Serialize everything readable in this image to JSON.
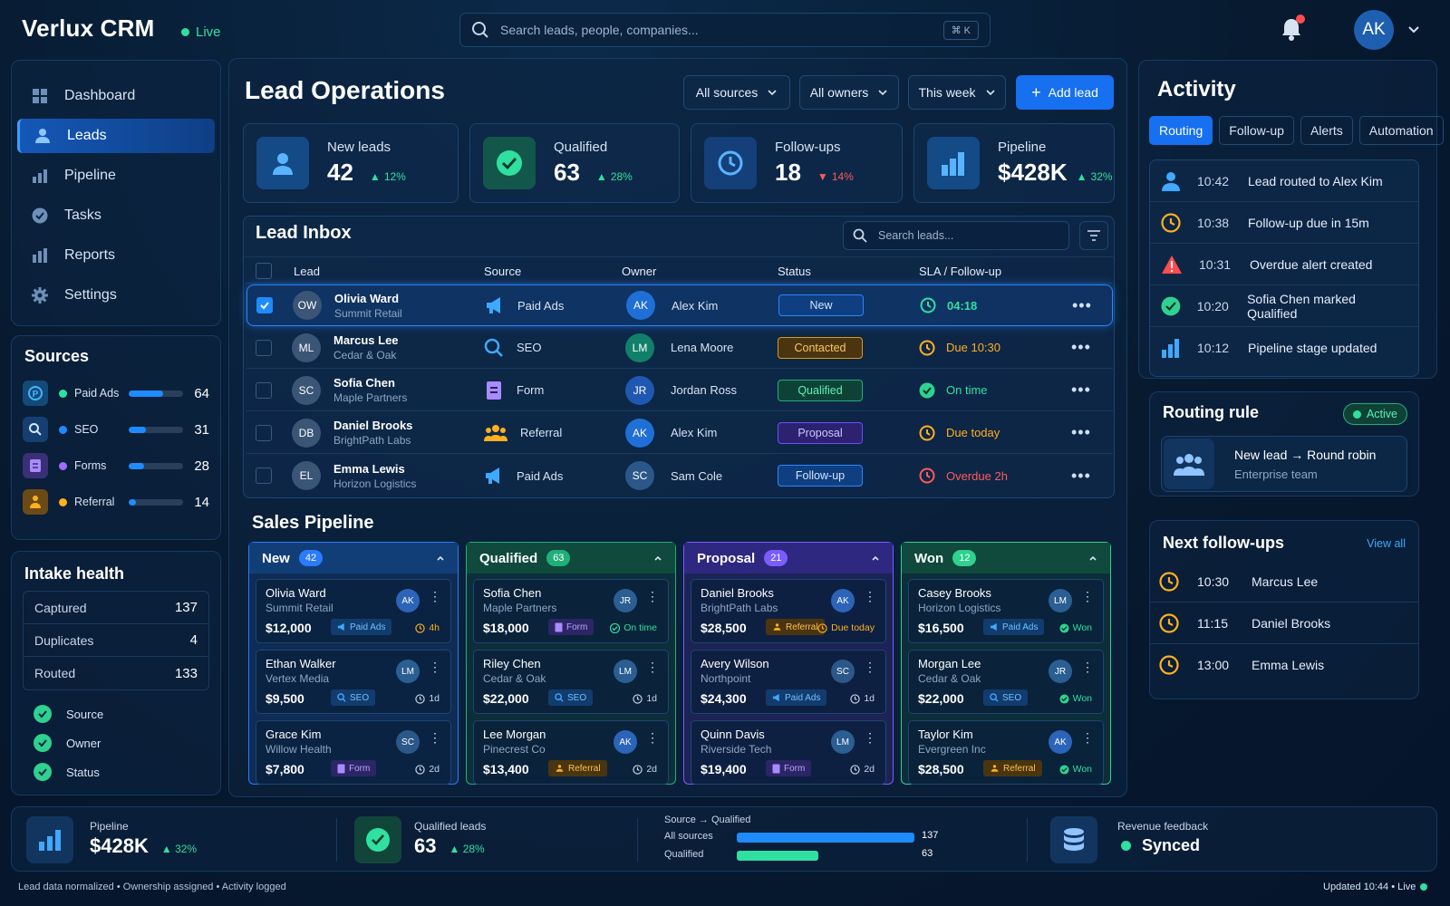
{
  "app": {
    "title": "Verlux CRM",
    "live": "Live"
  },
  "search": {
    "placeholder": "Search leads, people, companies...",
    "shortcut": "⌘ K"
  },
  "user": {
    "initials": "AK"
  },
  "sidebar": {
    "items": [
      {
        "label": "Dashboard",
        "icon": "grid-icon"
      },
      {
        "label": "Leads",
        "icon": "user-icon"
      },
      {
        "label": "Pipeline",
        "icon": "bar-chart-icon"
      },
      {
        "label": "Tasks",
        "icon": "check-circle-icon"
      },
      {
        "label": "Reports",
        "icon": "bar-chart-icon"
      },
      {
        "label": "Settings",
        "icon": "gear-icon"
      }
    ],
    "sources_title": "Sources",
    "sources": [
      {
        "label": "Paid Ads",
        "value": 64,
        "fraction": 0.64,
        "color": "#2fe0a0"
      },
      {
        "label": "SEO",
        "value": 31,
        "fraction": 0.31,
        "color": "#1e8bff"
      },
      {
        "label": "Forms",
        "value": 28,
        "fraction": 0.28,
        "color": "#a06bff"
      },
      {
        "label": "Referral",
        "value": 14,
        "fraction": 0.14,
        "color": "#ffb020"
      }
    ],
    "intake_title": "Intake health",
    "intake": [
      {
        "label": "Captured",
        "value": "137"
      },
      {
        "label": "Duplicates",
        "value": "4"
      },
      {
        "label": "Routed",
        "value": "133"
      }
    ],
    "checks": [
      "Source",
      "Owner",
      "Status"
    ]
  },
  "main": {
    "title": "Lead Operations",
    "filters": [
      "All sources",
      "All owners",
      "This week"
    ],
    "add_label": "Add lead",
    "kpis": [
      {
        "label": "New leads",
        "value": "42",
        "delta": "12%",
        "dir": "up"
      },
      {
        "label": "Qualified",
        "value": "63",
        "delta": "28%",
        "dir": "up"
      },
      {
        "label": "Follow-ups",
        "value": "18",
        "delta": "14%",
        "dir": "down"
      },
      {
        "label": "Pipeline",
        "value": "$428K",
        "delta": "32%",
        "dir": "up"
      }
    ]
  },
  "inbox": {
    "title": "Lead Inbox",
    "search_placeholder": "Search leads...",
    "columns": [
      "Lead",
      "Source",
      "Owner",
      "Status",
      "SLA / Follow-up"
    ],
    "rows": [
      {
        "initials": "OW",
        "name": "Olivia Ward",
        "company": "Summit Retail",
        "source": "Paid Ads",
        "owner_initials": "AK",
        "owner": "Alex Kim",
        "status": "New",
        "sla": "04:18",
        "sla_kind": "ok"
      },
      {
        "initials": "ML",
        "name": "Marcus Lee",
        "company": "Cedar & Oak",
        "source": "SEO",
        "owner_initials": "LM",
        "owner": "Lena Moore",
        "status": "Contacted",
        "sla": "Due 10:30",
        "sla_kind": "due"
      },
      {
        "initials": "SC",
        "name": "Sofia Chen",
        "company": "Maple Partners",
        "source": "Form",
        "owner_initials": "JR",
        "owner": "Jordan Ross",
        "status": "Qualified",
        "sla": "On time",
        "sla_kind": "done"
      },
      {
        "initials": "DB",
        "name": "Daniel Brooks",
        "company": "BrightPath Labs",
        "source": "Referral",
        "owner_initials": "AK",
        "owner": "Alex Kim",
        "status": "Proposal",
        "sla": "Due today",
        "sla_kind": "due"
      },
      {
        "initials": "EL",
        "name": "Emma Lewis",
        "company": "Horizon Logistics",
        "source": "Paid Ads",
        "owner_initials": "SC",
        "owner": "Sam Cole",
        "status": "Follow-up",
        "sla": "Overdue 2h",
        "sla_kind": "over"
      }
    ]
  },
  "pipeline": {
    "title": "Sales Pipeline",
    "columns": [
      {
        "name": "New",
        "count": "42",
        "color": "#2a7bff",
        "deals": [
          {
            "name": "Olivia Ward",
            "company": "Summit Retail",
            "amount": "$12,000",
            "owner": "AK",
            "tag": "Paid Ads",
            "sla": "4h",
            "sla_kind": "due"
          },
          {
            "name": "Ethan Walker",
            "company": "Vertex Media",
            "amount": "$9,500",
            "owner": "LM",
            "tag": "SEO",
            "sla": "1d",
            "sla_kind": "plain"
          },
          {
            "name": "Grace Kim",
            "company": "Willow Health",
            "amount": "$7,800",
            "owner": "SC",
            "tag": "Form",
            "sla": "2d",
            "sla_kind": "plain"
          }
        ]
      },
      {
        "name": "Qualified",
        "count": "63",
        "color": "#1fb07a",
        "deals": [
          {
            "name": "Sofia Chen",
            "company": "Maple Partners",
            "amount": "$18,000",
            "owner": "JR",
            "tag": "Form",
            "sla": "On time",
            "sla_kind": "ok"
          },
          {
            "name": "Riley Chen",
            "company": "Cedar & Oak",
            "amount": "$22,000",
            "owner": "LM",
            "tag": "SEO",
            "sla": "1d",
            "sla_kind": "plain"
          },
          {
            "name": "Lee Morgan",
            "company": "Pinecrest Co",
            "amount": "$13,400",
            "owner": "AK",
            "tag": "Referral",
            "sla": "2d",
            "sla_kind": "plain"
          }
        ]
      },
      {
        "name": "Proposal",
        "count": "21",
        "color": "#7a5cff",
        "deals": [
          {
            "name": "Daniel Brooks",
            "company": "BrightPath Labs",
            "amount": "$28,500",
            "owner": "AK",
            "tag": "Referral",
            "sla": "Due today",
            "sla_kind": "due"
          },
          {
            "name": "Avery Wilson",
            "company": "Northpoint",
            "amount": "$24,300",
            "owner": "SC",
            "tag": "Paid Ads",
            "sla": "1d",
            "sla_kind": "plain"
          },
          {
            "name": "Quinn Davis",
            "company": "Riverside Tech",
            "amount": "$19,400",
            "owner": "LM",
            "tag": "Form",
            "sla": "2d",
            "sla_kind": "plain"
          }
        ]
      },
      {
        "name": "Won",
        "count": "12",
        "color": "#2fd18f",
        "deals": [
          {
            "name": "Casey Brooks",
            "company": "Horizon Logistics",
            "amount": "$16,500",
            "owner": "LM",
            "tag": "Paid Ads",
            "sla": "Won",
            "sla_kind": "won"
          },
          {
            "name": "Morgan Lee",
            "company": "Cedar & Oak",
            "amount": "$22,000",
            "owner": "JR",
            "tag": "SEO",
            "sla": "Won",
            "sla_kind": "won"
          },
          {
            "name": "Taylor Kim",
            "company": "Evergreen Inc",
            "amount": "$28,500",
            "owner": "AK",
            "tag": "Referral",
            "sla": "Won",
            "sla_kind": "won"
          }
        ]
      }
    ]
  },
  "activity": {
    "title": "Activity",
    "tabs": [
      "Routing",
      "Follow-up",
      "Alerts",
      "Automation"
    ],
    "items": [
      {
        "time": "10:42",
        "text": "Lead routed to Alex Kim",
        "icon": "user-icon"
      },
      {
        "time": "10:38",
        "text": "Follow-up due in 15m",
        "icon": "clock-icon"
      },
      {
        "time": "10:31",
        "text": "Overdue alert created",
        "icon": "warning-icon"
      },
      {
        "time": "10:20",
        "text": "Sofia Chen marked Qualified",
        "icon": "check-circle-icon"
      },
      {
        "time": "10:12",
        "text": "Pipeline stage updated",
        "icon": "bar-chart-icon"
      }
    ]
  },
  "routing": {
    "title": "Routing rule",
    "status": "Active",
    "rule": "New lead → Round robin",
    "team": "Enterprise team"
  },
  "followups": {
    "title": "Next follow-ups",
    "view_all": "View all",
    "items": [
      {
        "time": "10:30",
        "name": "Marcus Lee"
      },
      {
        "time": "11:15",
        "name": "Daniel Brooks"
      },
      {
        "time": "13:00",
        "name": "Emma Lewis"
      }
    ]
  },
  "bottom": {
    "pipeline_label": "Pipeline",
    "pipeline_value": "$428K",
    "pipeline_delta": "32%",
    "qualified_label": "Qualified leads",
    "qualified_value": "63",
    "qualified_delta": "28%",
    "conv_title": "Source → Qualified",
    "conv": [
      {
        "label": "All sources",
        "value": "137",
        "fraction": 1.0,
        "color": "#1e8bff"
      },
      {
        "label": "Qualified",
        "value": "63",
        "fraction": 0.46,
        "color": "#2fe0a0"
      }
    ],
    "revenue_label": "Revenue feedback",
    "revenue_status": "Synced"
  },
  "footer": {
    "status": "Lead data normalized  •  Ownership assigned  •  Activity logged",
    "updated": "Updated 10:44  •  Live"
  }
}
